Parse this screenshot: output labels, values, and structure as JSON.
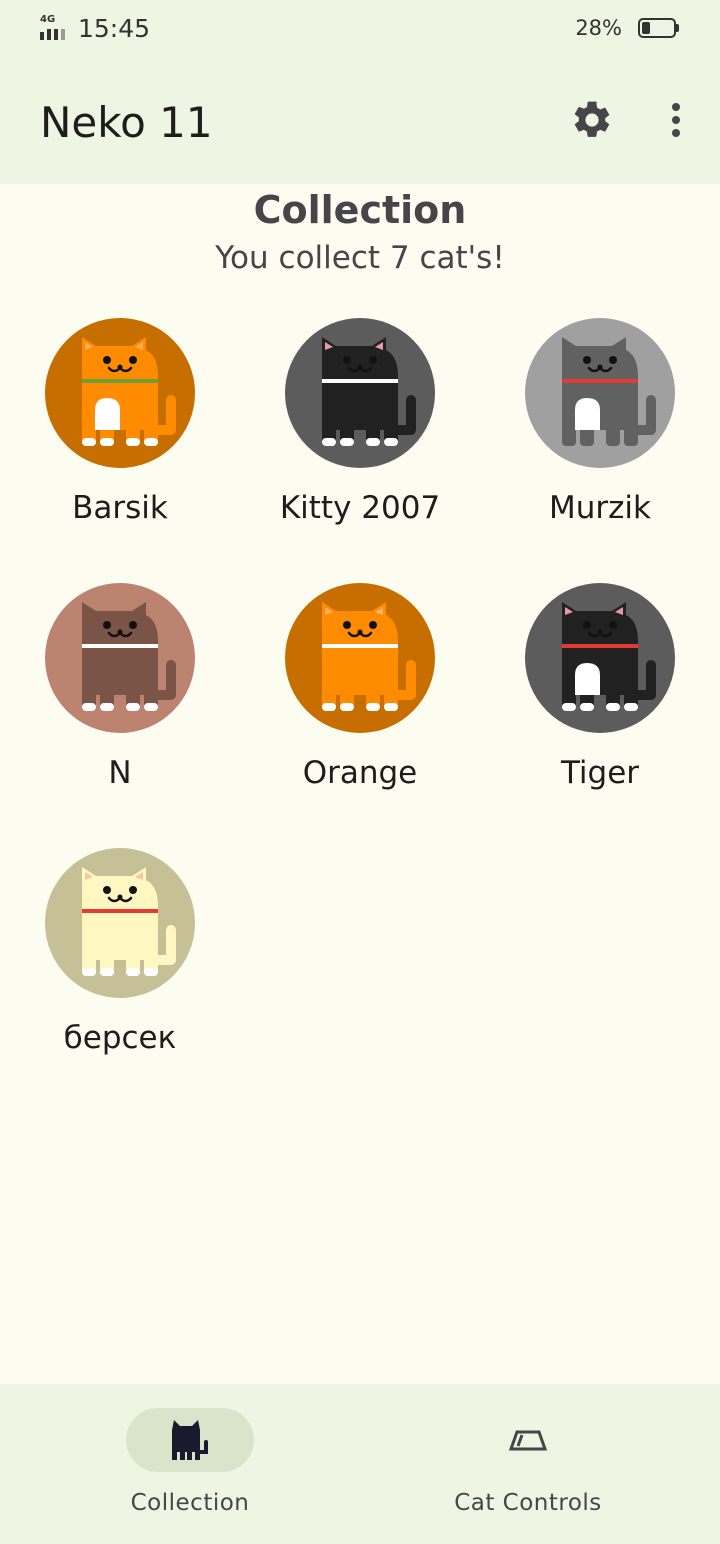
{
  "status_bar": {
    "network": "4G",
    "time": "15:45",
    "battery_percent": "28%",
    "battery_level": 0.28
  },
  "app_bar": {
    "title": "Neko 11",
    "settings_icon": "gear-icon",
    "more_icon": "more-vertical-icon"
  },
  "collection": {
    "title": "Collection",
    "subtitle": "You collect 7 cat's!"
  },
  "cats": [
    {
      "name": "Barsik",
      "bg": "#c66f00",
      "body": "#ff8c00",
      "collar": "#6a9f3a",
      "belly": "#ffffff",
      "paws": "#ffffff",
      "ears": "#ffb060"
    },
    {
      "name": "Kitty 2007",
      "bg": "#5c5c5c",
      "body": "#212121",
      "collar": "#ffffff",
      "belly": "",
      "paws": "#ffffff",
      "ears": "#e89aa0"
    },
    {
      "name": "Murzik",
      "bg": "#a0a0a0",
      "body": "#616161",
      "collar": "#e53935",
      "belly": "#ffffff",
      "paws": "",
      "ears": "#616161"
    },
    {
      "name": "N",
      "bg": "#bc8470",
      "body": "#7a5446",
      "collar": "#ffffff",
      "belly": "",
      "paws": "#ffffff",
      "ears": "#7a5446"
    },
    {
      "name": "Orange",
      "bg": "#c66f00",
      "body": "#ff8c00",
      "collar": "#ffffff",
      "belly": "",
      "paws": "#ffffff",
      "ears": "#ffb060"
    },
    {
      "name": "Tiger",
      "bg": "#5c5c5c",
      "body": "#212121",
      "collar": "#e53935",
      "belly": "#ffffff",
      "paws": "#ffffff",
      "ears": "#e89aa0"
    },
    {
      "name": "берсек",
      "bg": "#c5c096",
      "body": "#fff7c2",
      "collar": "#e53935",
      "belly": "",
      "paws": "#ffffff",
      "ears": "#f5c8a0"
    }
  ],
  "bottom_nav": {
    "items": [
      {
        "label": "Collection",
        "icon": "cat-icon",
        "active": true
      },
      {
        "label": "Cat Controls",
        "icon": "food-bowl-icon",
        "active": false
      }
    ]
  },
  "colors": {
    "app_bar_bg": "#eef5e3",
    "page_bg": "#fdfcf1",
    "active_pill": "#d8e5cb",
    "text_secondary": "#45454a"
  }
}
